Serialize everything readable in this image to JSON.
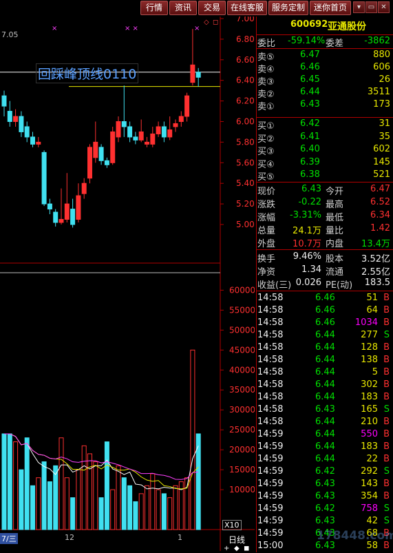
{
  "toolbar": {
    "tabs": [
      "行情",
      "资讯",
      "交易",
      "在线客服",
      "服务定制",
      "迷你首页"
    ],
    "win_buttons": [
      "▾",
      "▭",
      "✕"
    ]
  },
  "chart": {
    "price_label_top": "7.05",
    "annotation": "回踩峰顶线0110",
    "price_axis": [
      "7.00",
      "6.80",
      "6.60",
      "6.40",
      "6.20",
      "6.00",
      "5.80",
      "5.60",
      "5.40",
      "5.20",
      "5.00"
    ],
    "volume_axis": [
      "60000",
      "55000",
      "50000",
      "45000",
      "40000",
      "35000",
      "30000",
      "25000",
      "20000",
      "15000",
      "10000"
    ],
    "x_labels": [
      "12",
      "1"
    ],
    "x_left_label": "7/三",
    "x10": "X10",
    "period": "日线",
    "markers": [
      "×",
      "× ×",
      "×"
    ],
    "top_icons": [
      "◇",
      "◻"
    ],
    "bottom_icons": [
      "+",
      "◆",
      "◼"
    ]
  },
  "chart_data": {
    "type": "candlestick",
    "ylim": [
      4.95,
      7.05
    ],
    "candles": [
      [
        6.25,
        6.15,
        6.3,
        6.05
      ],
      [
        6.1,
        6.0,
        6.2,
        5.95
      ],
      [
        6.0,
        6.05,
        6.12,
        5.95
      ],
      [
        6.05,
        5.9,
        6.1,
        5.85
      ],
      [
        5.95,
        5.85,
        6.0,
        5.8
      ],
      [
        5.85,
        5.78,
        5.9,
        5.75
      ],
      [
        5.78,
        5.8,
        5.85,
        5.75
      ],
      [
        5.7,
        5.2,
        5.72,
        5.18
      ],
      [
        5.2,
        5.15,
        5.25,
        5.1
      ],
      [
        5.12,
        5.02,
        5.15,
        4.98
      ],
      [
        5.02,
        5.05,
        5.35,
        5.0
      ],
      [
        5.05,
        5.2,
        5.5,
        5.02
      ],
      [
        5.15,
        5.0,
        5.25,
        4.97
      ],
      [
        5.05,
        5.28,
        5.4,
        5.02
      ],
      [
        5.3,
        5.4,
        5.45,
        5.25
      ],
      [
        5.45,
        5.75,
        5.78,
        5.4
      ],
      [
        5.65,
        5.8,
        6.0,
        5.6
      ],
      [
        5.75,
        5.62,
        5.78,
        5.58
      ],
      [
        5.62,
        5.58,
        5.65,
        5.55
      ],
      [
        5.6,
        5.9,
        5.95,
        5.58
      ],
      [
        5.85,
        6.0,
        6.05,
        5.8
      ],
      [
        6.0,
        5.95,
        6.35,
        5.85
      ],
      [
        5.95,
        5.85,
        6.0,
        5.8
      ],
      [
        5.85,
        5.82,
        5.9,
        5.78
      ],
      [
        5.82,
        5.9,
        6.02,
        5.8
      ],
      [
        5.78,
        5.8,
        5.85,
        5.75
      ],
      [
        5.78,
        5.88,
        5.95,
        5.75
      ],
      [
        5.88,
        5.95,
        6.0,
        5.85
      ],
      [
        5.95,
        5.85,
        6.0,
        5.8
      ],
      [
        5.85,
        5.92,
        6.05,
        5.82
      ],
      [
        5.95,
        5.98,
        6.02,
        5.9
      ],
      [
        6.0,
        6.05,
        6.1,
        5.95
      ],
      [
        6.05,
        6.25,
        6.28,
        6.0
      ],
      [
        6.38,
        6.55,
        6.9,
        6.35
      ],
      [
        6.48,
        6.43,
        6.52,
        6.34
      ]
    ],
    "reference_lines": [
      6.48,
      6.34
    ],
    "volume": [
      24000,
      24000,
      22000,
      15000,
      23000,
      11000,
      13000,
      17000,
      12000,
      16000,
      23000,
      13000,
      8000,
      15000,
      21000,
      19000,
      17000,
      8000,
      22000,
      10000,
      16000,
      13000,
      11000,
      7000,
      9000,
      11000,
      14000,
      10000,
      9000,
      8000,
      11000,
      12000,
      13000,
      45000,
      24000
    ],
    "volume_ylim": [
      0,
      63000
    ]
  },
  "quote": {
    "code": "600692",
    "name": "亚通股份",
    "weibi_label": "委比",
    "weibi": "-59.14%",
    "weicha_label": "委差",
    "weicha": "-3862",
    "sells": [
      {
        "label": "卖⑤",
        "price": "6.47",
        "vol": "880"
      },
      {
        "label": "卖④",
        "price": "6.46",
        "vol": "606"
      },
      {
        "label": "卖③",
        "price": "6.45",
        "vol": "26"
      },
      {
        "label": "卖②",
        "price": "6.44",
        "vol": "3511"
      },
      {
        "label": "卖①",
        "price": "6.43",
        "vol": "173"
      }
    ],
    "buys": [
      {
        "label": "买①",
        "price": "6.42",
        "vol": "31"
      },
      {
        "label": "买②",
        "price": "6.41",
        "vol": "35"
      },
      {
        "label": "买③",
        "price": "6.40",
        "vol": "602"
      },
      {
        "label": "买④",
        "price": "6.39",
        "vol": "145"
      },
      {
        "label": "买⑤",
        "price": "6.38",
        "vol": "521"
      }
    ],
    "stats": [
      {
        "l1": "现价",
        "v1": "6.43",
        "l2": "今开",
        "v2": "6.47"
      },
      {
        "l1": "涨跌",
        "v1": "-0.22",
        "l2": "最高",
        "v2": "6.52"
      },
      {
        "l1": "涨幅",
        "v1": "-3.31%",
        "l2": "最低",
        "v2": "6.34"
      },
      {
        "l1": "总量",
        "v1": "24.1万",
        "l2": "量比",
        "v2": "1.42"
      },
      {
        "l1": "外盘",
        "v1": "10.7万",
        "l2": "内盘",
        "v2": "13.4万"
      }
    ],
    "stats2": [
      {
        "l1": "换手",
        "v1": "9.46%",
        "l2": "股本",
        "v2": "3.52亿"
      },
      {
        "l1": "净资",
        "v1": "1.34",
        "l2": "流通",
        "v2": "2.55亿"
      },
      {
        "l1": "收益(三)",
        "v1": "0.026",
        "l2": "PE(动)",
        "v2": "183.5"
      }
    ],
    "ticks": [
      {
        "t": "14:58",
        "p": "6.46",
        "v": "51",
        "s": "B"
      },
      {
        "t": "14:58",
        "p": "6.46",
        "v": "64",
        "s": "B"
      },
      {
        "t": "14:58",
        "p": "6.46",
        "v": "1034",
        "s": "B"
      },
      {
        "t": "14:58",
        "p": "6.44",
        "v": "277",
        "s": "S"
      },
      {
        "t": "14:58",
        "p": "6.44",
        "v": "128",
        "s": "B"
      },
      {
        "t": "14:58",
        "p": "6.44",
        "v": "138",
        "s": "B"
      },
      {
        "t": "14:58",
        "p": "6.44",
        "v": "5",
        "s": "B"
      },
      {
        "t": "14:58",
        "p": "6.44",
        "v": "302",
        "s": "B"
      },
      {
        "t": "14:58",
        "p": "6.44",
        "v": "183",
        "s": "B"
      },
      {
        "t": "14:58",
        "p": "6.43",
        "v": "165",
        "s": "S"
      },
      {
        "t": "14:58",
        "p": "6.44",
        "v": "210",
        "s": "B"
      },
      {
        "t": "14:59",
        "p": "6.44",
        "v": "550",
        "s": "B"
      },
      {
        "t": "14:59",
        "p": "6.44",
        "v": "183",
        "s": "B"
      },
      {
        "t": "14:59",
        "p": "6.44",
        "v": "22",
        "s": "B"
      },
      {
        "t": "14:59",
        "p": "6.42",
        "v": "292",
        "s": "S"
      },
      {
        "t": "14:59",
        "p": "6.43",
        "v": "143",
        "s": "B"
      },
      {
        "t": "14:59",
        "p": "6.43",
        "v": "354",
        "s": "B"
      },
      {
        "t": "14:59",
        "p": "6.42",
        "v": "758",
        "s": "S"
      },
      {
        "t": "14:59",
        "p": "6.43",
        "v": "42",
        "s": "S"
      },
      {
        "t": "14:59",
        "p": "6.43",
        "v": "68",
        "s": "B"
      },
      {
        "t": "15:00",
        "p": "6.43",
        "v": "58",
        "s": "B"
      }
    ]
  },
  "watermark": "178448.com"
}
